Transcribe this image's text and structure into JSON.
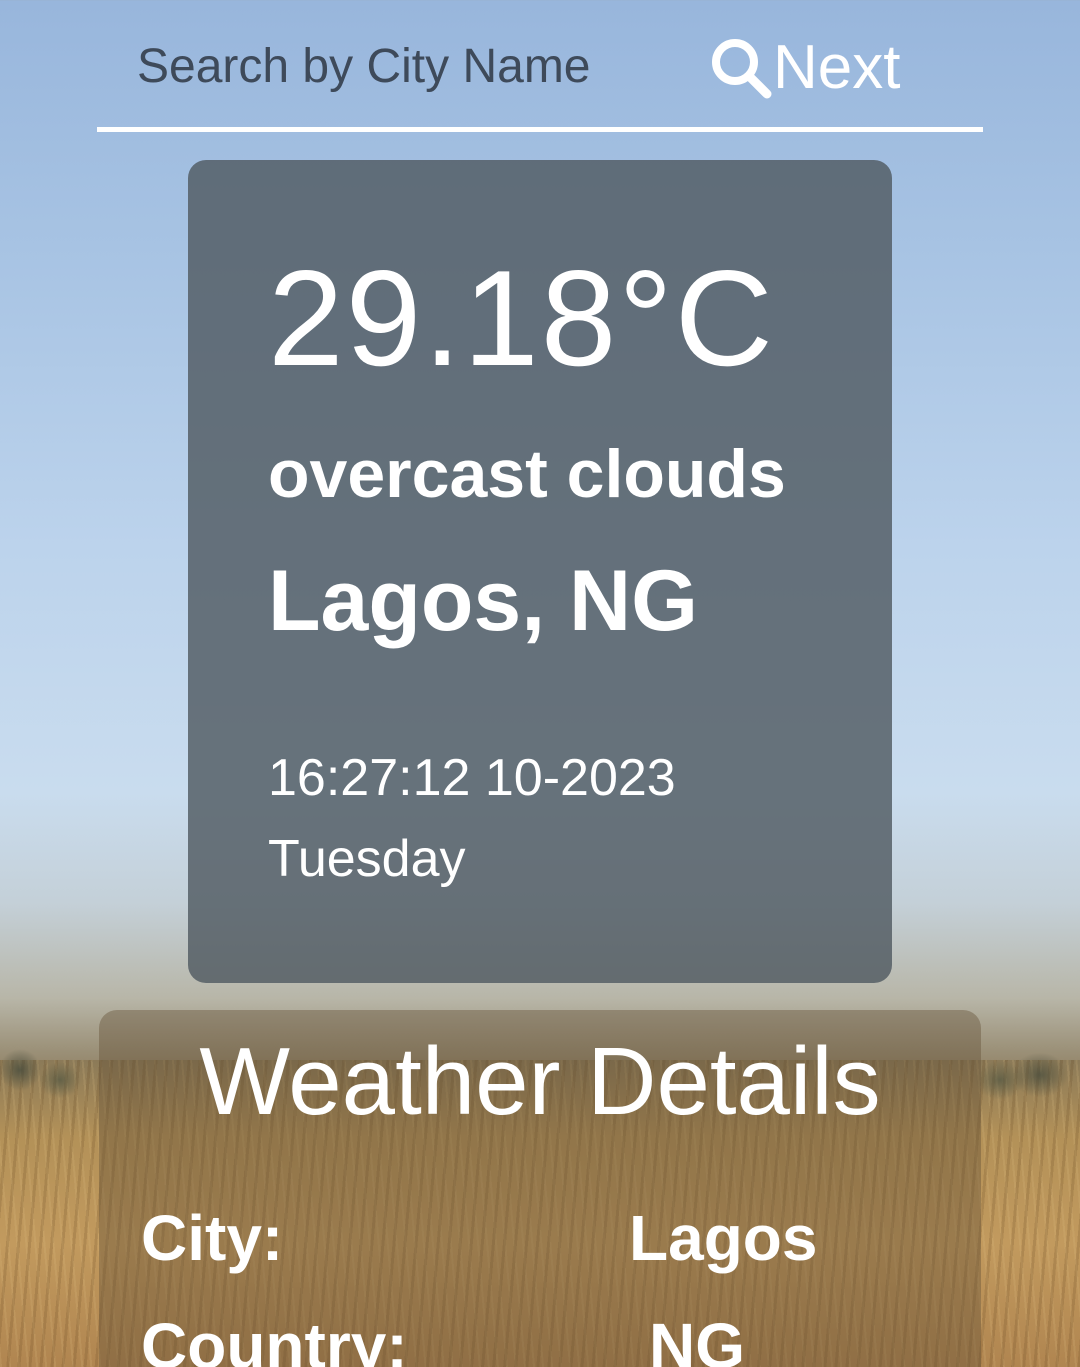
{
  "search": {
    "placeholder": "Search by City Name",
    "button_label": "Next",
    "button_icon": "search-icon"
  },
  "current": {
    "temperature": "29.18°C",
    "description": "overcast clouds",
    "location": "Lagos, NG",
    "datetime": "16:27:12 10-2023",
    "weekday": "Tuesday"
  },
  "details": {
    "title": "Weather Details",
    "rows": [
      {
        "label": "City:",
        "value": "Lagos"
      },
      {
        "label": "Country:",
        "value": "NG"
      }
    ]
  },
  "colors": {
    "card_background": "#505a62",
    "text": "#ffffff",
    "placeholder_text": "#3e4a5a"
  }
}
